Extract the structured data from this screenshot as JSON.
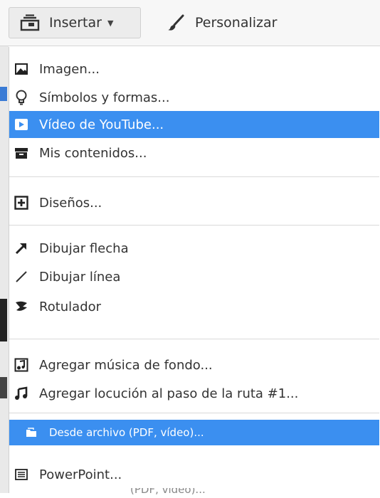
{
  "toolbar": {
    "insert_label": "Insertar",
    "insert_icon": "insert-stack-icon",
    "personalize_label": "Personalizar",
    "personalize_icon": "brush-icon"
  },
  "menu": {
    "items": [
      {
        "label": "Imagen...",
        "icon": "image-icon"
      },
      {
        "label": "Símbolos y formas...",
        "icon": "lightbulb-icon"
      },
      {
        "label": "Vídeo de YouTube...",
        "icon": "youtube-play-icon",
        "selected": true
      },
      {
        "label": "Mis contenidos...",
        "icon": "archive-box-icon"
      },
      {
        "label": "Diseños...",
        "icon": "plus-square-icon"
      },
      {
        "label": "Dibujar flecha",
        "icon": "arrow-icon"
      },
      {
        "label": "Dibujar línea",
        "icon": "line-icon"
      },
      {
        "label": "Rotulador",
        "icon": "marker-icon"
      },
      {
        "label": "Agregar música de fondo...",
        "icon": "music-file-icon"
      },
      {
        "label": "Agregar locución al paso de la ruta #1...",
        "icon": "music-note-icon"
      },
      {
        "label": "Desde archivo (PDF, vídeo)...",
        "icon": "folder-icon",
        "selected": true
      },
      {
        "label": "PowerPoint...",
        "icon": "slides-icon"
      }
    ],
    "ghost_text": "(PDF, vídeo)..."
  },
  "colors": {
    "highlight": "#3b8ff0",
    "text": "#333333",
    "separator": "#d9d9d9"
  }
}
